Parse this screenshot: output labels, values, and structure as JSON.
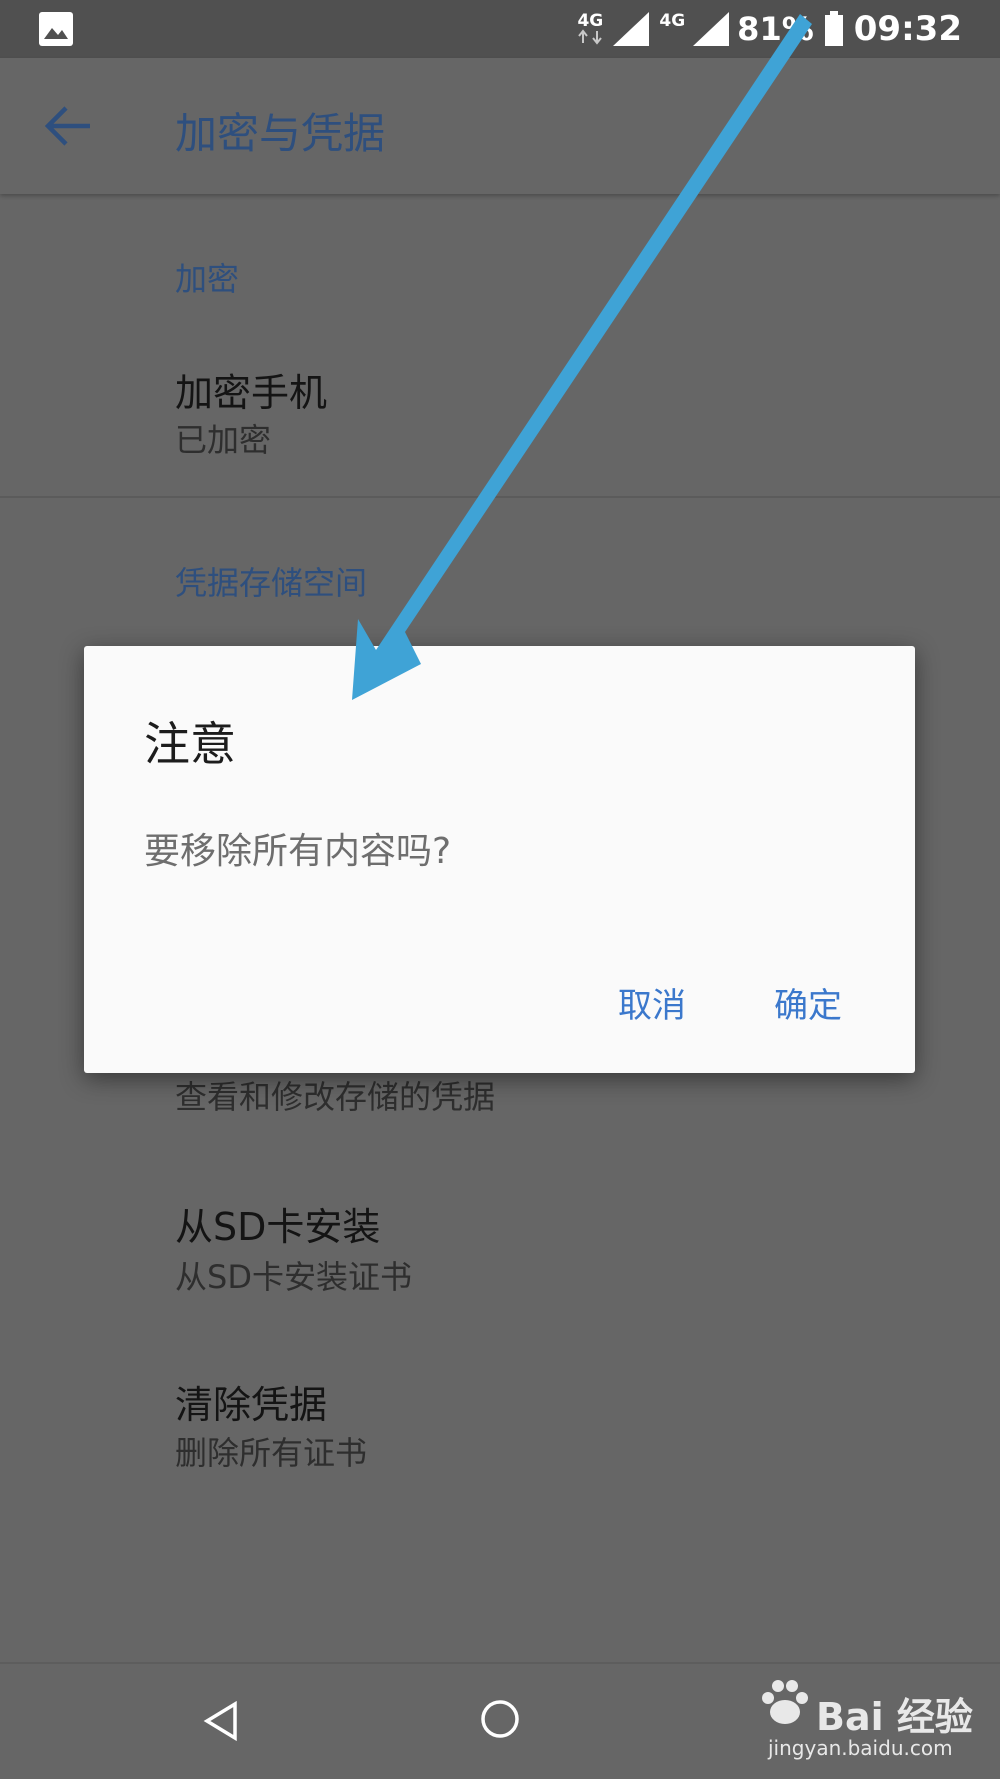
{
  "status_bar": {
    "network_1": "4G",
    "network_2": "4G",
    "battery": "81%",
    "time": "09:32",
    "icons": [
      "gallery-icon",
      "data-arrows-icon",
      "signal-icon",
      "battery-icon"
    ]
  },
  "app_bar": {
    "title": "加密与凭据",
    "back_icon": "arrow-left-icon"
  },
  "sections": {
    "encryption": {
      "header": "加密",
      "item_title": "加密手机",
      "item_sub": "已加密"
    },
    "credential_storage": {
      "header": "凭据存储空间",
      "trusted_sub": "查看和修改存储的凭据",
      "install_title": "从SD卡安装",
      "install_sub": "从SD卡安装证书",
      "clear_title": "清除凭据",
      "clear_sub": "删除所有证书"
    }
  },
  "dialog": {
    "title": "注意",
    "message": "要移除所有内容吗?",
    "cancel": "取消",
    "ok": "确定"
  },
  "nav_bar": {
    "icons": [
      "back-triangle-icon",
      "home-circle-icon"
    ]
  },
  "watermark": {
    "text": "Bai 经验",
    "url": "jingyan.baidu.com"
  },
  "colors": {
    "dim_background": "#666666",
    "accent_dim": "#2e4f7e",
    "dialog_button": "#3b78cc",
    "annotation_arrow": "#3fa3d6"
  }
}
